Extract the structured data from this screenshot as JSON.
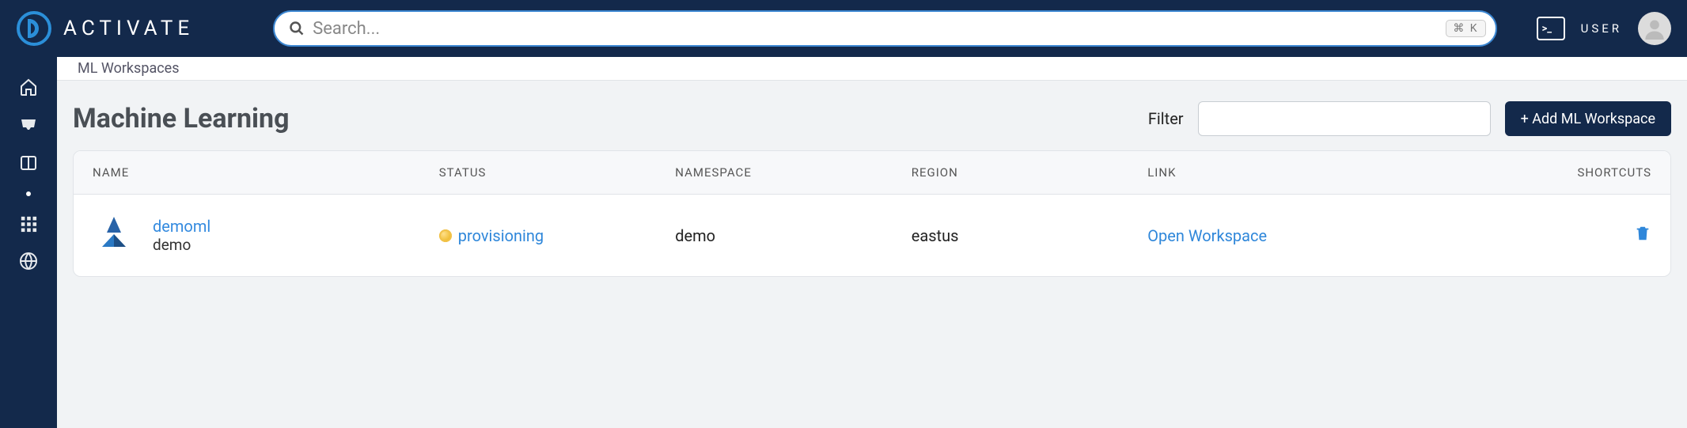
{
  "header": {
    "brand": "ACTIVATE",
    "search_placeholder": "Search...",
    "shortcut_key": "⌘ K",
    "user_label": "USER"
  },
  "breadcrumb": "ML Workspaces",
  "page_title": "Machine Learning",
  "filter": {
    "label": "Filter",
    "value": ""
  },
  "add_button": "+ Add ML Workspace",
  "columns": {
    "name": "NAME",
    "status": "STATUS",
    "namespace": "NAMESPACE",
    "region": "REGION",
    "link": "LINK",
    "shortcuts": "SHORTCUTS"
  },
  "rows": [
    {
      "name": "demoml",
      "subtitle": "demo",
      "status": "provisioning",
      "namespace": "demo",
      "region": "eastus",
      "link_label": "Open Workspace"
    }
  ]
}
